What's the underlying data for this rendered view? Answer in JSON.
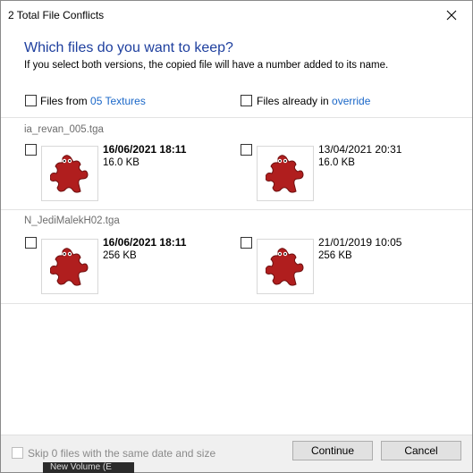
{
  "window": {
    "title": "2 Total File Conflicts"
  },
  "header": {
    "question": "Which files do you want to keep?",
    "note": "If you select both versions, the copied file will have a number added to its name."
  },
  "columns": {
    "left": {
      "prefix": "Files from ",
      "source": "05 Textures"
    },
    "right": {
      "prefix": "Files already in ",
      "source": "override"
    }
  },
  "files": [
    {
      "name": "ia_revan_005.tga",
      "source": {
        "date": "16/06/2021 18:11",
        "size": "16.0 KB"
      },
      "dest": {
        "date": "13/04/2021 20:31",
        "size": "16.0 KB"
      }
    },
    {
      "name": "N_JediMalekH02.tga",
      "source": {
        "date": "16/06/2021 18:11",
        "size": "256 KB"
      },
      "dest": {
        "date": "21/01/2019 10:05",
        "size": "256 KB"
      }
    }
  ],
  "footer": {
    "skip_label": "Skip 0 files with the same date and size",
    "continue_label": "Continue",
    "cancel_label": "Cancel"
  },
  "taskbar": {
    "peek_text": "New Volume (E"
  },
  "icons": {
    "close": "close-icon",
    "file": "irfanview-puzzle-icon"
  },
  "colors": {
    "heading": "#1e3f9e",
    "link": "#1a67c8",
    "icon": "#b01e1e"
  }
}
